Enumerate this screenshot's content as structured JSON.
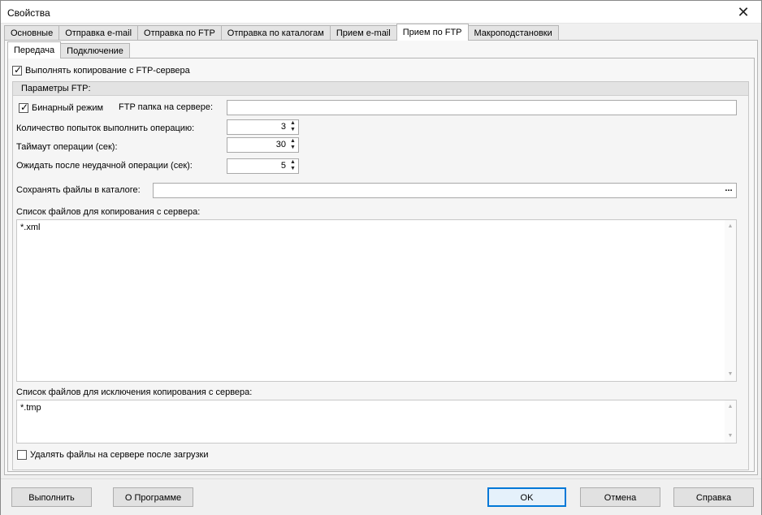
{
  "window": {
    "title": "Свойства"
  },
  "main_tabs": [
    {
      "label": "Основные",
      "active": false
    },
    {
      "label": "Отправка e-mail",
      "active": false
    },
    {
      "label": "Отправка по FTP",
      "active": false
    },
    {
      "label": "Отправка по каталогам",
      "active": false
    },
    {
      "label": "Прием e-mail",
      "active": false
    },
    {
      "label": "Прием по FTP",
      "active": true
    },
    {
      "label": "Макроподстановки",
      "active": false
    }
  ],
  "sub_tabs": [
    {
      "label": "Передача",
      "active": true
    },
    {
      "label": "Подключение",
      "active": false
    }
  ],
  "copy_from_ftp": {
    "label": "Выполнять копирование с FTP-сервера",
    "checked": true
  },
  "ftp_params": {
    "title": "Параметры FTP:",
    "binary_mode": {
      "label": "Бинарный режим",
      "checked": true
    },
    "server_folder": {
      "label": "FTP папка на сервере:",
      "value": ""
    },
    "retries": {
      "label": "Количество попыток выполнить операцию:",
      "value": "3"
    },
    "timeout": {
      "label": "Таймаут операции (сек):",
      "value": "30"
    },
    "wait_after_fail": {
      "label": "Ожидать после неудачной операции (сек):",
      "value": "5"
    },
    "save_dir": {
      "label": "Сохранять файлы в каталоге:",
      "value": "",
      "browse": "..."
    },
    "copy_list": {
      "label": "Список файлов для копирования с сервера:",
      "value": "*.xml"
    },
    "exclude_list": {
      "label": "Список файлов для исключения копирования с сервера:",
      "value": "*.tmp"
    },
    "delete_after": {
      "label": "Удалять файлы на сервере после загрузки",
      "checked": false
    }
  },
  "footer": {
    "run": "Выполнить",
    "about": "О Программе",
    "ok": "OK",
    "cancel": "Отмена",
    "help": "Справка"
  }
}
